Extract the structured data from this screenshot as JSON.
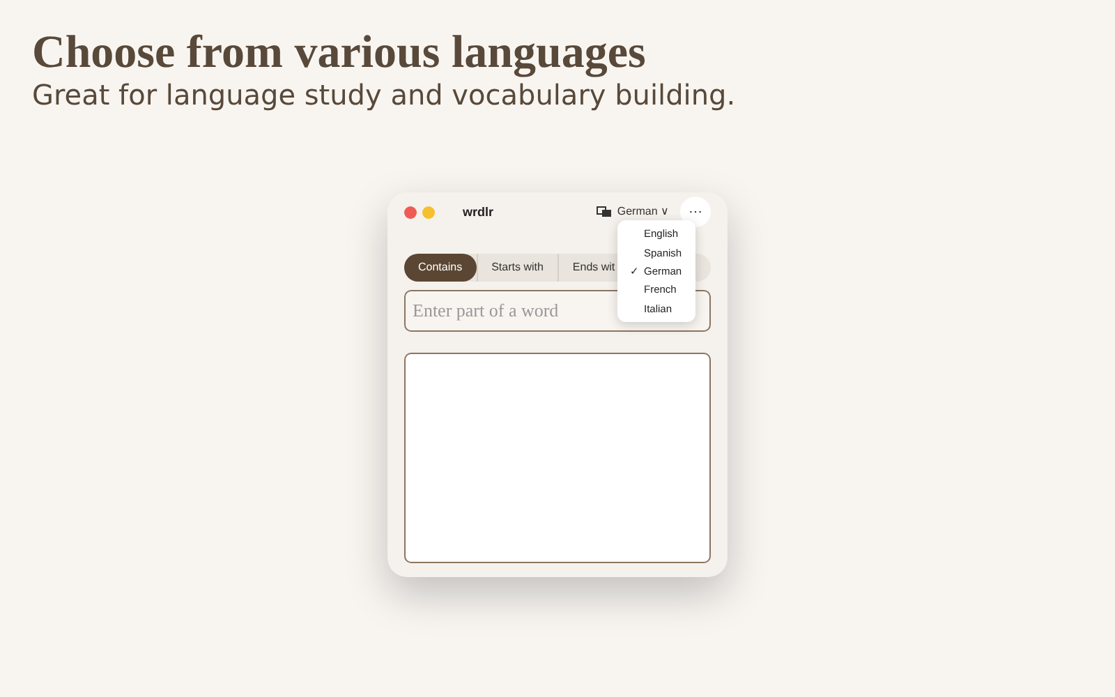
{
  "headline": "Choose from various languages",
  "subtitle": "Great for language study and vocabulary building.",
  "window": {
    "title": "wrdlr",
    "language_button": {
      "label": "German",
      "caret": "∨"
    },
    "more_button": "⋯",
    "modes": [
      {
        "label": "Contains",
        "selected": true
      },
      {
        "label": "Starts with",
        "selected": false
      },
      {
        "label": "Ends wit",
        "selected": false
      }
    ],
    "search": {
      "placeholder": "Enter part of a word"
    },
    "language_menu": [
      {
        "label": "English",
        "selected": false
      },
      {
        "label": "Spanish",
        "selected": false
      },
      {
        "label": "German",
        "selected": true
      },
      {
        "label": "French",
        "selected": false
      },
      {
        "label": "Italian",
        "selected": false
      }
    ],
    "check_mark": "✓"
  }
}
